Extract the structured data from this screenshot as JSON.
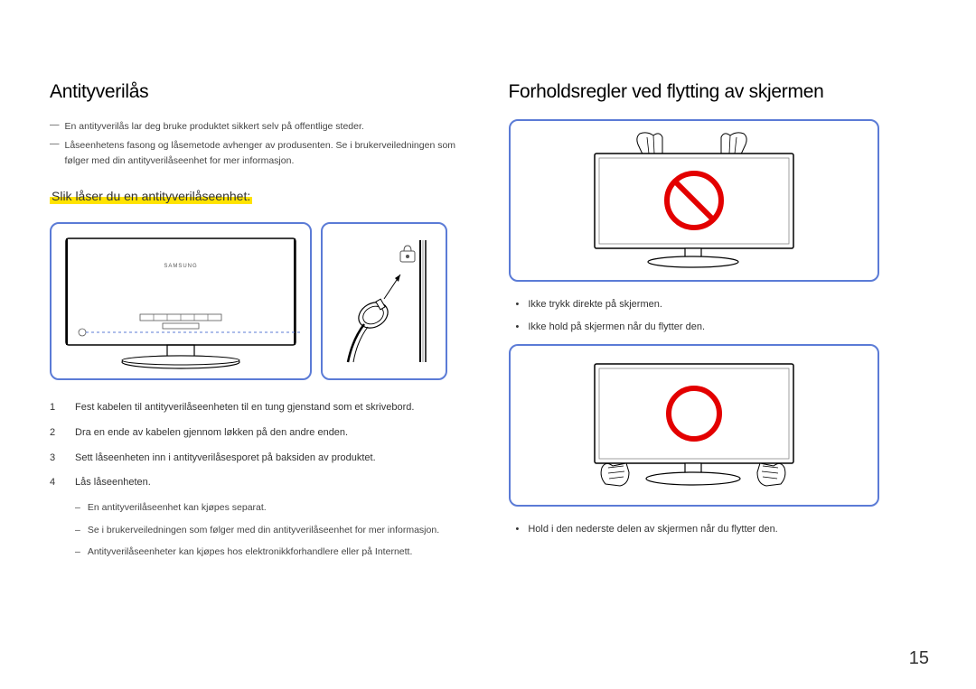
{
  "page_number": "15",
  "left_col": {
    "heading": "Antityverilås",
    "footnote1": "En antityverilås lar deg bruke produktet sikkert selv på offentlige steder.",
    "footnote2": "Låseenhetens fasong og låsemetode avhenger av produsenten. Se i brukerveiledningen som følger med din antityverilåseenhet for mer informasjon.",
    "subheading": "Slik låser du en antityverilåseenhet:",
    "steps": [
      "Fest kabelen til antityverilåseenheten til en tung gjenstand som et skrivebord.",
      "Dra en ende av kabelen gjennom løkken på den andre enden.",
      "Sett låseenheten inn i antityverilåsesporet på baksiden av produktet.",
      "Lås låseenheten."
    ],
    "sub_items": [
      "En antityverilåseenhet kan kjøpes separat.",
      "Se i brukerveiledningen som følger med din antityverilåseenhet for mer informasjon.",
      "Antityverilåseenheter kan kjøpes hos elektronikkforhandlere eller på Internett."
    ]
  },
  "right_col": {
    "heading": "Forholdsregler ved flytting av skjermen",
    "wrong_bullets": [
      "Ikke trykk direkte på skjermen.",
      "Ikke hold på skjermen når du flytter den."
    ],
    "correct_bullet": "Hold i den nederste delen av skjermen når du flytter den."
  }
}
